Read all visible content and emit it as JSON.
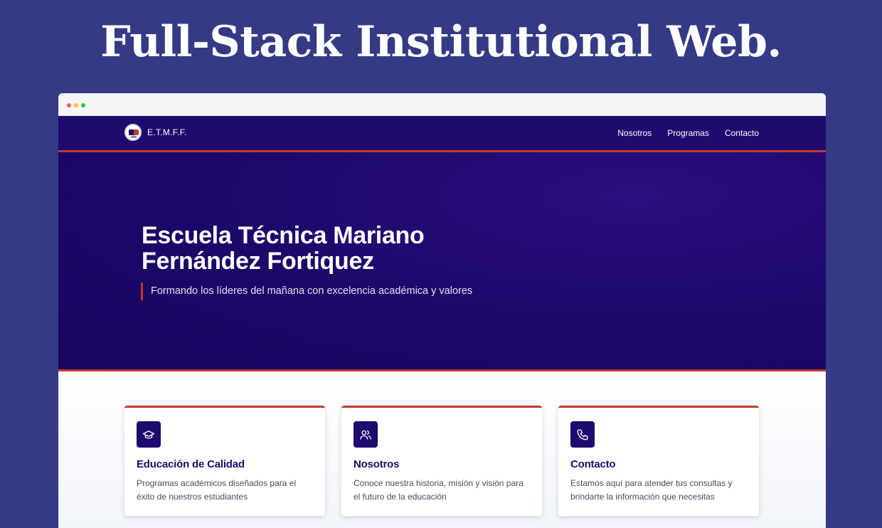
{
  "headline": "Full-Stack Institutional Web.",
  "browser": {
    "window_dots": [
      "red",
      "yellow",
      "green"
    ]
  },
  "navbar": {
    "brand": "E.T.M.F.F.",
    "links": [
      "Nosotros",
      "Programas",
      "Contacto"
    ]
  },
  "hero": {
    "title": "Escuela Técnica Mariano Fernández Fortiquez",
    "tagline": "Formando los líderes del mañana con excelencia académica y valores"
  },
  "features": [
    {
      "icon": "graduation-cap-icon",
      "title": "Educación de Calidad",
      "text": "Programas académicos diseñados para el éxito de nuestros estudiantes"
    },
    {
      "icon": "users-icon",
      "title": "Nosotros",
      "text": "Conoce nuestra historia, misión y visión para el futuro de la educación"
    },
    {
      "icon": "phone-icon",
      "title": "Contacto",
      "text": "Estamos aquí para atender tus consultas y brindarte la información que necesitas"
    }
  ],
  "colors": {
    "page_background": "#343a84",
    "primary": "#1f0a6e",
    "accent": "#c0392b"
  }
}
